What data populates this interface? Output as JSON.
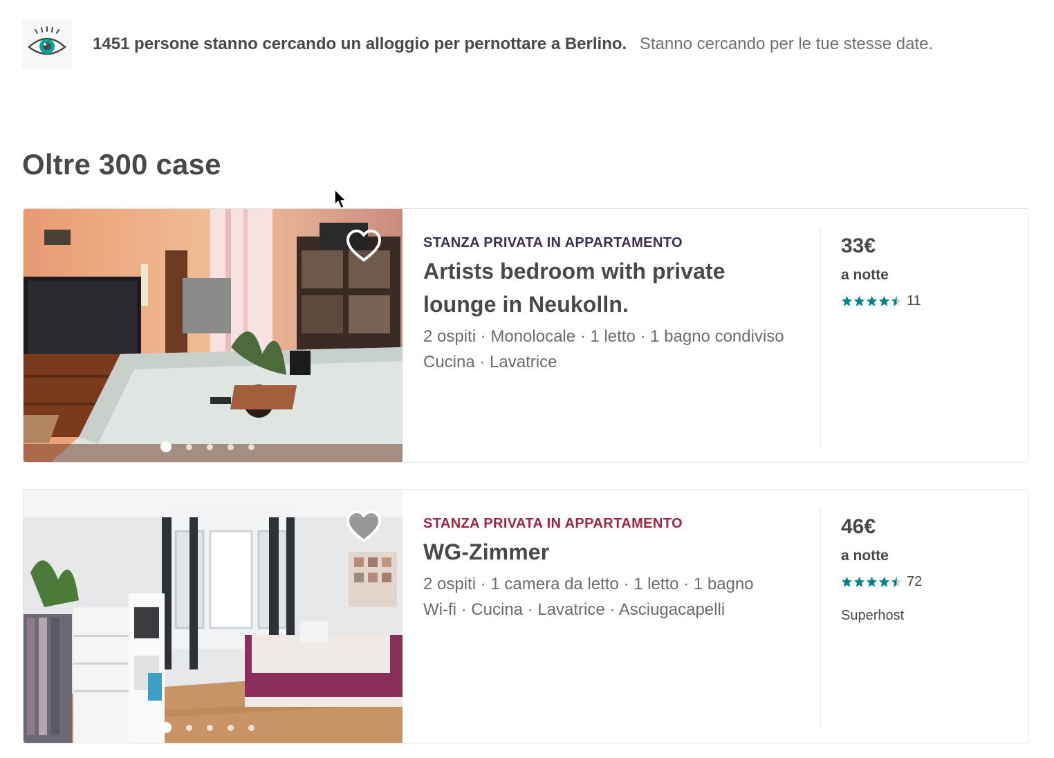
{
  "banner": {
    "headline": "1451 persone stanno cercando un alloggio per pernottare a Berlino.",
    "subtext": "Stanno cercando per le tue stesse date.",
    "icon": "eye-icon"
  },
  "section": {
    "title": "Oltre 300 case"
  },
  "listings": [
    {
      "kind": "STANZA PRIVATA IN APPARTAMENTO",
      "title_line1": "Artists bedroom with private",
      "title_line2": "lounge in Neukolln.",
      "details": "2 ospiti · Monolocale · 1 letto · 1 bagno condiviso",
      "amenities": "Cucina · Lavatrice",
      "price": "33€",
      "per_night": "a notte",
      "rating": 4.5,
      "reviews": "11",
      "photo_count": 5,
      "current_photo": 1
    },
    {
      "kind": "STANZA PRIVATA IN APPARTAMENTO",
      "title": "WG-Zimmer",
      "details": "2 ospiti · 1 camera da letto · 1 letto · 1 bagno",
      "amenities": "Wi-fi · Cucina · Lavatrice · Asciugacapelli",
      "price": "46€",
      "per_night": "a notte",
      "rating": 4.5,
      "reviews": "72",
      "badge": "Superhost",
      "photo_count": 5,
      "current_photo": 1
    }
  ],
  "colors": {
    "accent_teal": "#008489",
    "kind_purple": "#3b2d4f",
    "kind_red": "#9c2541",
    "text": "#484848"
  }
}
